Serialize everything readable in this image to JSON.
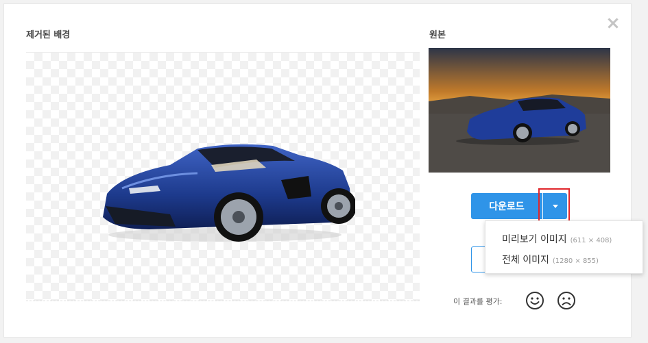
{
  "modal": {
    "close_icon": "close-icon",
    "removed_background_label": "제거된 배경",
    "original_label": "원본"
  },
  "download": {
    "button_label": "다운로드",
    "dropdown_icon": "caret-down-icon",
    "menu": [
      {
        "name": "미리보기 이미지",
        "size": "(611 × 408)"
      },
      {
        "name": "전체 이미지",
        "size": "(1280 × 855)"
      }
    ]
  },
  "rating": {
    "label": "이 결과를 평가:",
    "icons": [
      "smile-face-icon",
      "sad-face-icon"
    ]
  },
  "colors": {
    "accent": "#2f94e8",
    "highlight": "#e0262c"
  }
}
